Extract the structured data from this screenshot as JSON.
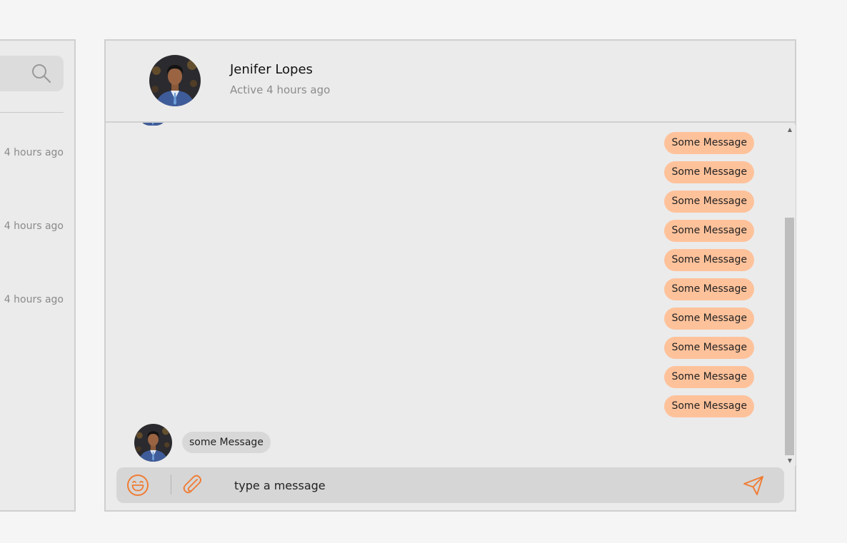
{
  "sidebar": {
    "search_icon": "search-icon",
    "conversations": [
      {
        "time": "4 hours ago"
      },
      {
        "time": "4 hours ago"
      },
      {
        "time": "4 hours ago"
      }
    ]
  },
  "chat": {
    "contact": {
      "name": "Jenifer Lopes",
      "status": "Active 4 hours ago"
    },
    "sent_messages": [
      "Some Message",
      "Some Message",
      "Some Message",
      "Some Message",
      "Some Message",
      "Some Message",
      "Some Message",
      "Some Message",
      "Some Message",
      "Some Message"
    ],
    "received_messages": [
      "some Message"
    ],
    "composer": {
      "placeholder": "type a message",
      "emoji_icon": "emoji-icon",
      "attach_icon": "paperclip-icon",
      "send_icon": "send-icon"
    }
  },
  "colors": {
    "accent": "#f07c34",
    "sent_bubble": "#fec29b",
    "received_bubble": "#d8d8d8",
    "panel_bg": "#ebebeb",
    "page_bg": "#f5f5f5"
  }
}
